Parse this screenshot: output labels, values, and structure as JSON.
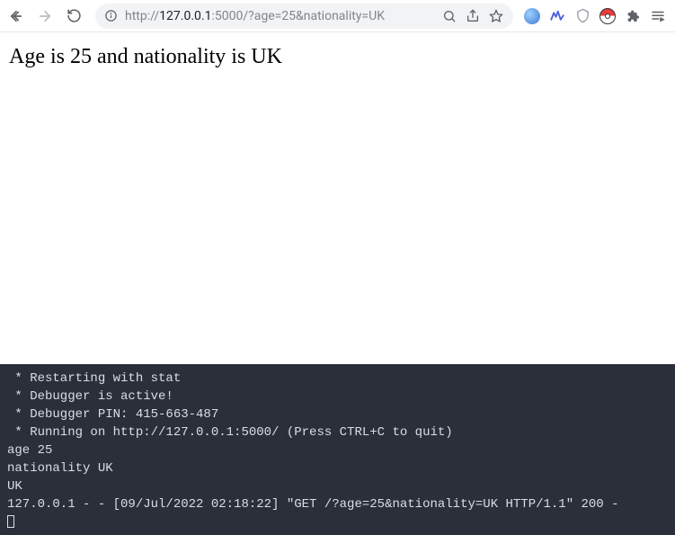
{
  "toolbar": {
    "url_prefix": "http://",
    "url_host": "127.0.0.1",
    "url_port": ":5000",
    "url_path": "/?age=25&nationality=UK"
  },
  "page": {
    "heading": "Age is 25 and nationality is UK"
  },
  "terminal": {
    "lines": [
      " * Restarting with stat",
      " * Debugger is active!",
      " * Debugger PIN: 415-663-487",
      " * Running on http://127.0.0.1:5000/ (Press CTRL+C to quit)",
      "age 25",
      "nationality UK",
      "UK",
      "127.0.0.1 - - [09/Jul/2022 02:18:22] \"GET /?age=25&nationality=UK HTTP/1.1\" 200 -"
    ]
  }
}
